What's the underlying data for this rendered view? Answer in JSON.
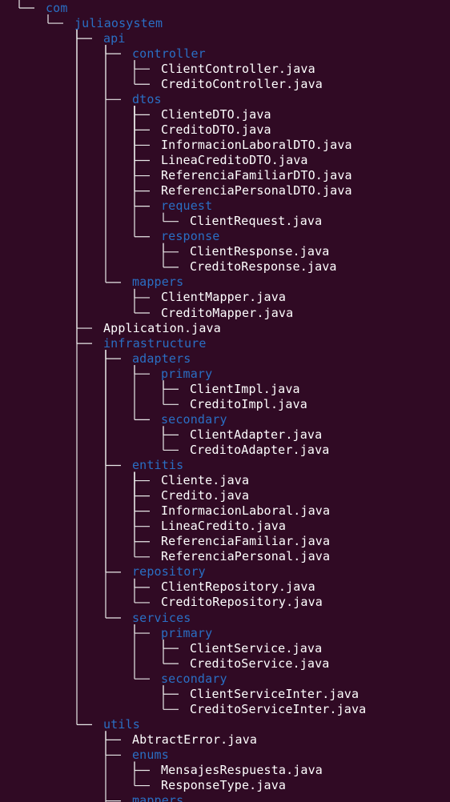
{
  "terminal": {
    "background": "#300a24",
    "text_color": "#ffffff",
    "directory_color": "#2a6fc4",
    "line_color": "#e8e8e8"
  },
  "tree": [
    {
      "name": "com",
      "type": "dir",
      "depth": 0,
      "last": true
    },
    {
      "name": "juliaosystem",
      "type": "dir",
      "depth": 1,
      "last": true
    },
    {
      "name": "api",
      "type": "dir",
      "depth": 2,
      "last": false
    },
    {
      "name": "controller",
      "type": "dir",
      "depth": 3,
      "last": false
    },
    {
      "name": "ClientController.java",
      "type": "file",
      "depth": 4,
      "last": false
    },
    {
      "name": "CreditoController.java",
      "type": "file",
      "depth": 4,
      "last": true
    },
    {
      "name": "dtos",
      "type": "dir",
      "depth": 3,
      "last": false
    },
    {
      "name": "ClienteDTO.java",
      "type": "file",
      "depth": 4,
      "last": false
    },
    {
      "name": "CreditoDTO.java",
      "type": "file",
      "depth": 4,
      "last": false
    },
    {
      "name": "InformacionLaboralDTO.java",
      "type": "file",
      "depth": 4,
      "last": false
    },
    {
      "name": "LineaCreditoDTO.java",
      "type": "file",
      "depth": 4,
      "last": false
    },
    {
      "name": "ReferenciaFamiliarDTO.java",
      "type": "file",
      "depth": 4,
      "last": false
    },
    {
      "name": "ReferenciaPersonalDTO.java",
      "type": "file",
      "depth": 4,
      "last": false
    },
    {
      "name": "request",
      "type": "dir",
      "depth": 4,
      "last": false
    },
    {
      "name": "ClientRequest.java",
      "type": "file",
      "depth": 5,
      "last": true
    },
    {
      "name": "response",
      "type": "dir",
      "depth": 4,
      "last": true
    },
    {
      "name": "ClientResponse.java",
      "type": "file",
      "depth": 5,
      "last": false
    },
    {
      "name": "CreditoResponse.java",
      "type": "file",
      "depth": 5,
      "last": true
    },
    {
      "name": "mappers",
      "type": "dir",
      "depth": 3,
      "last": true
    },
    {
      "name": "ClientMapper.java",
      "type": "file",
      "depth": 4,
      "last": false
    },
    {
      "name": "CreditoMapper.java",
      "type": "file",
      "depth": 4,
      "last": true
    },
    {
      "name": "Application.java",
      "type": "file",
      "depth": 2,
      "last": false
    },
    {
      "name": "infrastructure",
      "type": "dir",
      "depth": 2,
      "last": false
    },
    {
      "name": "adapters",
      "type": "dir",
      "depth": 3,
      "last": false
    },
    {
      "name": "primary",
      "type": "dir",
      "depth": 4,
      "last": false
    },
    {
      "name": "ClientImpl.java",
      "type": "file",
      "depth": 5,
      "last": false
    },
    {
      "name": "CreditoImpl.java",
      "type": "file",
      "depth": 5,
      "last": true
    },
    {
      "name": "secondary",
      "type": "dir",
      "depth": 4,
      "last": true
    },
    {
      "name": "ClientAdapter.java",
      "type": "file",
      "depth": 5,
      "last": false
    },
    {
      "name": "CreditoAdapter.java",
      "type": "file",
      "depth": 5,
      "last": true
    },
    {
      "name": "entitis",
      "type": "dir",
      "depth": 3,
      "last": false
    },
    {
      "name": "Cliente.java",
      "type": "file",
      "depth": 4,
      "last": false
    },
    {
      "name": "Credito.java",
      "type": "file",
      "depth": 4,
      "last": false
    },
    {
      "name": "InformacionLaboral.java",
      "type": "file",
      "depth": 4,
      "last": false
    },
    {
      "name": "LineaCredito.java",
      "type": "file",
      "depth": 4,
      "last": false
    },
    {
      "name": "ReferenciaFamiliar.java",
      "type": "file",
      "depth": 4,
      "last": false
    },
    {
      "name": "ReferenciaPersonal.java",
      "type": "file",
      "depth": 4,
      "last": true
    },
    {
      "name": "repository",
      "type": "dir",
      "depth": 3,
      "last": false
    },
    {
      "name": "ClientRepository.java",
      "type": "file",
      "depth": 4,
      "last": false
    },
    {
      "name": "CreditoRepository.java",
      "type": "file",
      "depth": 4,
      "last": true
    },
    {
      "name": "services",
      "type": "dir",
      "depth": 3,
      "last": true
    },
    {
      "name": "primary",
      "type": "dir",
      "depth": 4,
      "last": false
    },
    {
      "name": "ClientService.java",
      "type": "file",
      "depth": 5,
      "last": false
    },
    {
      "name": "CreditoService.java",
      "type": "file",
      "depth": 5,
      "last": true
    },
    {
      "name": "secondary",
      "type": "dir",
      "depth": 4,
      "last": true
    },
    {
      "name": "ClientServiceInter.java",
      "type": "file",
      "depth": 5,
      "last": false
    },
    {
      "name": "CreditoServiceInter.java",
      "type": "file",
      "depth": 5,
      "last": true
    },
    {
      "name": "utils",
      "type": "dir",
      "depth": 2,
      "last": true
    },
    {
      "name": "AbtractError.java",
      "type": "file",
      "depth": 3,
      "last": false
    },
    {
      "name": "enums",
      "type": "dir",
      "depth": 3,
      "last": false
    },
    {
      "name": "MensajesRespuesta.java",
      "type": "file",
      "depth": 4,
      "last": false
    },
    {
      "name": "ResponseType.java",
      "type": "file",
      "depth": 4,
      "last": true
    },
    {
      "name": "mappers",
      "type": "dir",
      "depth": 3,
      "last": false
    }
  ]
}
